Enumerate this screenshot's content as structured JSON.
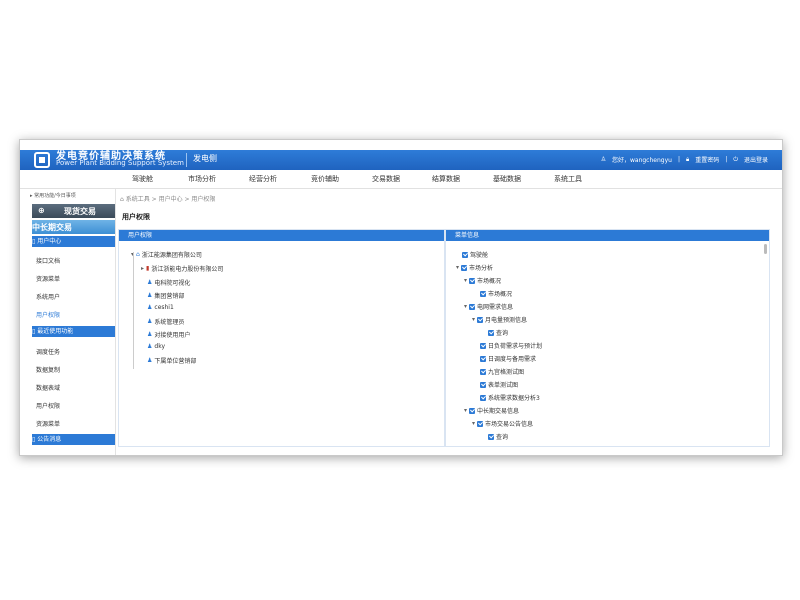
{
  "header": {
    "title_cn": "发电竞价辅助决策系统",
    "title_en": "Power Plant Bidding Support System",
    "side": "发电侧",
    "user_text": "您好，wangchengyu",
    "settings_text": "重置密码",
    "logout_text": "退出登录"
  },
  "nav": [
    "驾驶舱",
    "市场分析",
    "经营分析",
    "竞价辅助",
    "交易数据",
    "结算数据",
    "基础数据",
    "系统工具"
  ],
  "sidebar": {
    "recent": "常用功能/今日事项",
    "banner_spot": "现货交易",
    "banner_mid": "中长期交易",
    "group_user_center": "用户中心",
    "user_center_items": [
      "接口文档",
      "资源菜单",
      "系统用户",
      "用户权限"
    ],
    "group_recent": "最近使用功能",
    "recent_items": [
      "调度任务",
      "数据复制",
      "数据表域",
      "用户权限",
      "资源菜单"
    ],
    "group_notice": "公告消息"
  },
  "breadcrumb": "系统工具 > 用户中心 > 用户权限",
  "page_title": "用户权限",
  "user_panel": {
    "header": "用户权限",
    "root": "浙江能源集团有限公司",
    "child": "浙江浙能电力股份有限公司",
    "users": [
      "电科院可视化",
      "集团营销部",
      "ceshi1",
      "系统管理员",
      "对接使用用户",
      "dky",
      "下属单位营销部"
    ]
  },
  "menu_panel": {
    "header": "菜单信息",
    "items": [
      "驾驶舱",
      "市场分析",
      "市场概况",
      "市场概况",
      "电网需求信息",
      "月电量预测信息",
      "查询",
      "日负荷需求与预计划",
      "日调度与备用需求",
      "九宫格测试图",
      "表单测试图",
      "系统需求数据分析3",
      "中长期交易信息",
      "市场交易公告信息",
      "查询"
    ]
  }
}
